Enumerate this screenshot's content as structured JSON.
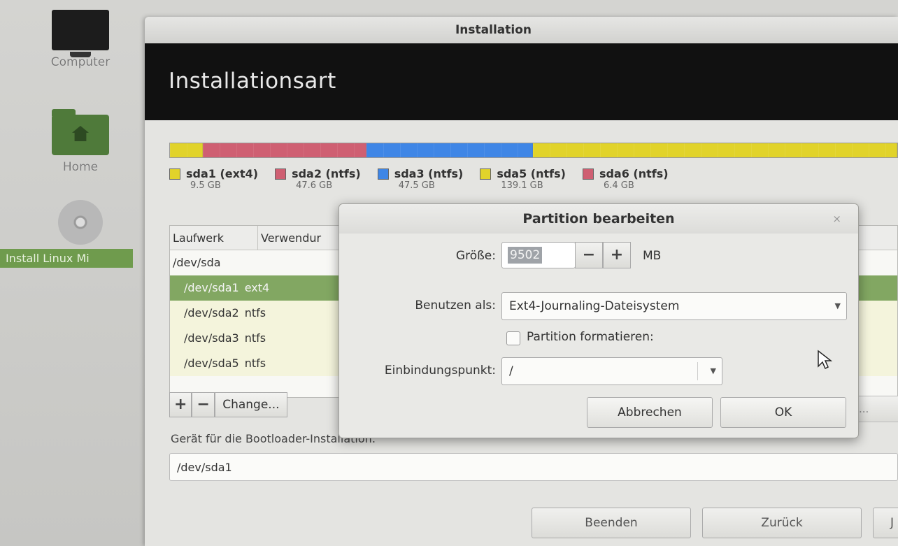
{
  "desktop": {
    "icons": [
      {
        "label": "Computer"
      },
      {
        "label": "Home"
      },
      {
        "label": "Install Linux Mi"
      }
    ]
  },
  "window": {
    "title": "Installation",
    "heading": "Installationsart"
  },
  "partition_bar": [
    {
      "name": "sda1 (ext4)",
      "size": "9.5 GB",
      "color": "#e1d32a"
    },
    {
      "name": "sda2 (ntfs)",
      "size": "47.6 GB",
      "color": "#cf5f72"
    },
    {
      "name": "sda3 (ntfs)",
      "size": "47.5 GB",
      "color": "#3f86e6"
    },
    {
      "name": "sda5 (ntfs)",
      "size": "139.1 GB",
      "color": "#e1d32a"
    },
    {
      "name": "sda6 (ntfs)",
      "size": "6.4 GB",
      "color": "#cf5f72"
    }
  ],
  "table": {
    "headers": [
      "Laufwerk",
      "Verwendur"
    ],
    "rows": [
      {
        "device": "/dev/sda",
        "fs": ""
      },
      {
        "device": "/dev/sda1",
        "fs": "ext4",
        "selected": true
      },
      {
        "device": "/dev/sda2",
        "fs": "ntfs"
      },
      {
        "device": "/dev/sda3",
        "fs": "ntfs"
      },
      {
        "device": "/dev/sda5",
        "fs": "ntfs"
      }
    ],
    "add_label": "+",
    "remove_label": "−",
    "change_label": "Change...",
    "hidden_button_label": "..."
  },
  "bootloader": {
    "label": "Gerät für die Bootloader-Installation:",
    "value": "/dev/sda1"
  },
  "footer": {
    "quit_label": "Beenden",
    "back_label": "Zurück",
    "next_label": "J"
  },
  "dialog": {
    "title": "Partition bearbeiten",
    "close_glyph": "×",
    "size_label": "Größe:",
    "size_value": "9502",
    "size_unit": "MB",
    "minus_label": "−",
    "plus_label": "+",
    "use_as_label": "Benutzen als:",
    "use_as_value": "Ext4-Journaling-Dateisystem",
    "format_label": "Partition formatieren:",
    "format_checked": false,
    "mount_label": "Einbindungspunkt:",
    "mount_value": "/",
    "cancel_label": "Abbrechen",
    "ok_label": "OK"
  }
}
